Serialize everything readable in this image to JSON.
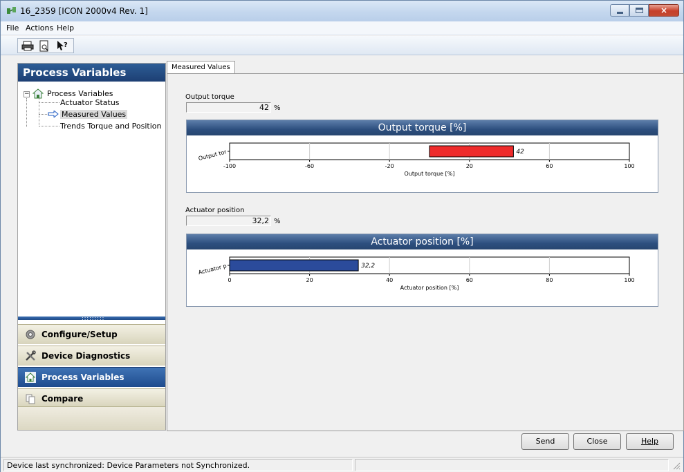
{
  "window": {
    "title": "16_2359 [ICON 2000v4 Rev. 1]",
    "close_glyph": "×"
  },
  "menu": {
    "file": "File",
    "actions": "Actions",
    "help": "Help"
  },
  "toolbar": {
    "icons": [
      "printer-icon",
      "print-preview-icon",
      "context-help-icon"
    ]
  },
  "left_panel": {
    "header": "Process Variables",
    "tree": {
      "root": "Process Variables",
      "root_expander": "−",
      "children": [
        "Actuator Status",
        "Measured Values",
        "Trends Torque and Position"
      ],
      "selected": "Measured Values"
    },
    "nav": [
      {
        "label": "Configure/Setup",
        "icon": "gear-icon",
        "active": false
      },
      {
        "label": "Device Diagnostics",
        "icon": "tools-icon",
        "active": false
      },
      {
        "label": "Process Variables",
        "icon": "house-icon",
        "active": true
      },
      {
        "label": "Compare",
        "icon": "compare-icon",
        "active": false
      }
    ]
  },
  "tab": {
    "label": "Measured Values"
  },
  "fields": {
    "torque": {
      "label": "Output torque",
      "value": "42",
      "unit": "%"
    },
    "position": {
      "label": "Actuator position",
      "value": "32,2",
      "unit": "%"
    }
  },
  "chart_data": [
    {
      "type": "bar",
      "title": "Output torque [%]",
      "xlabel": "Output torque [%]",
      "ylabel": "Output tor",
      "categories": [
        "Output tor"
      ],
      "values": [
        42
      ],
      "value_label": "42",
      "xlim": [
        -100,
        100
      ],
      "xticks": [
        -100,
        -60,
        -20,
        20,
        60,
        100
      ],
      "bar_start": 0,
      "bar_color": "#ee2b2b",
      "grid": true,
      "orientation": "horizontal"
    },
    {
      "type": "bar",
      "title": "Actuator position [%]",
      "xlabel": "Actuator position [%]",
      "ylabel": "Actuator p",
      "categories": [
        "Actuator p"
      ],
      "values": [
        32.2
      ],
      "value_label": "32,2",
      "xlim": [
        0,
        100
      ],
      "xticks": [
        0,
        20,
        40,
        60,
        80,
        100
      ],
      "bar_start": 0,
      "bar_color": "#2b4b9b",
      "grid": true,
      "orientation": "horizontal"
    }
  ],
  "buttons": {
    "send": "Send",
    "close": "Close",
    "help": "Help"
  },
  "status": {
    "text": "Device last synchronized: Device Parameters not Synchronized."
  }
}
